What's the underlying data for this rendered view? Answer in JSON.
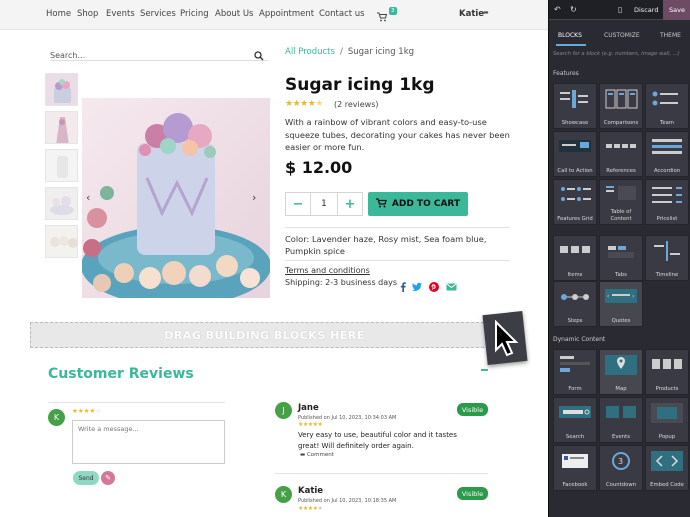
{
  "nav": {
    "items": [
      "Home",
      "Shop",
      "Events",
      "Services",
      "Pricing",
      "About Us",
      "Appointment",
      "Contact us"
    ],
    "cart_count": "3",
    "user": "Katie"
  },
  "search": {
    "placeholder": "Search..."
  },
  "breadcrumb": {
    "link": "All Products",
    "separator": "/",
    "current": "Sugar icing 1kg"
  },
  "product": {
    "title": "Sugar icing 1kg",
    "rating": 4.5,
    "reviews": "(2 reviews)",
    "description": "With a rainbow of vibrant colors and easy-to-use squeeze tubes, decorating your cakes has never been easier or more fun.",
    "price": "$ 12.00",
    "quantity": "1",
    "add_to_cart": "ADD TO CART",
    "color_info": "Color: Lavender haze, Rosy mist, Sea foam blue, Pumpkin spice",
    "terms": "Terms and conditions",
    "shipping": "Shipping: 2-3 business days"
  },
  "dropzone": {
    "label": "DRAG BUILDING BLOCKS HERE"
  },
  "reviews_section": {
    "title": "Customer Reviews",
    "author_initial": "K",
    "message_placeholder": "Write a message...",
    "send_label": "Send",
    "items": [
      {
        "initial": "J",
        "name": "Jane",
        "date": "Published on Jul 10, 2023, 10:34:03 AM",
        "text": "Very easy to use, beautiful color and it tastes great! Will definitely order again.",
        "comment": "Comment",
        "badge": "Visible"
      },
      {
        "initial": "K",
        "name": "Katie",
        "date": "Published on Jul 10, 2023, 10:18:35 AM",
        "text": "",
        "comment": "",
        "badge": "Visible"
      }
    ]
  },
  "editor": {
    "discard": "Discard",
    "save": "Save",
    "tabs": [
      "BLOCKS",
      "CUSTOMIZE",
      "THEME"
    ],
    "search_placeholder": "Search for a block (e.g. numbers, image wall, ...)",
    "sections": [
      {
        "title": "Features",
        "blocks": [
          "Showcase",
          "Comparisons",
          "Team",
          "Call to Action",
          "References",
          "Accordion",
          "Features Grid",
          "Table of Content",
          "Pricelist",
          "Items",
          "Tabs",
          "Timeline",
          "Steps",
          "Quotes"
        ]
      },
      {
        "title": "Dynamic Content",
        "blocks": [
          "Form",
          "Map",
          "Products",
          "Search",
          "Events",
          "Popup",
          "Facebook",
          "Countdown",
          "Embed Code"
        ]
      }
    ]
  },
  "colors": {
    "accent": "#3bb89a",
    "panel": "#2a2a33",
    "save": "#6e4b65",
    "visible_badge": "#2a9b4b"
  }
}
